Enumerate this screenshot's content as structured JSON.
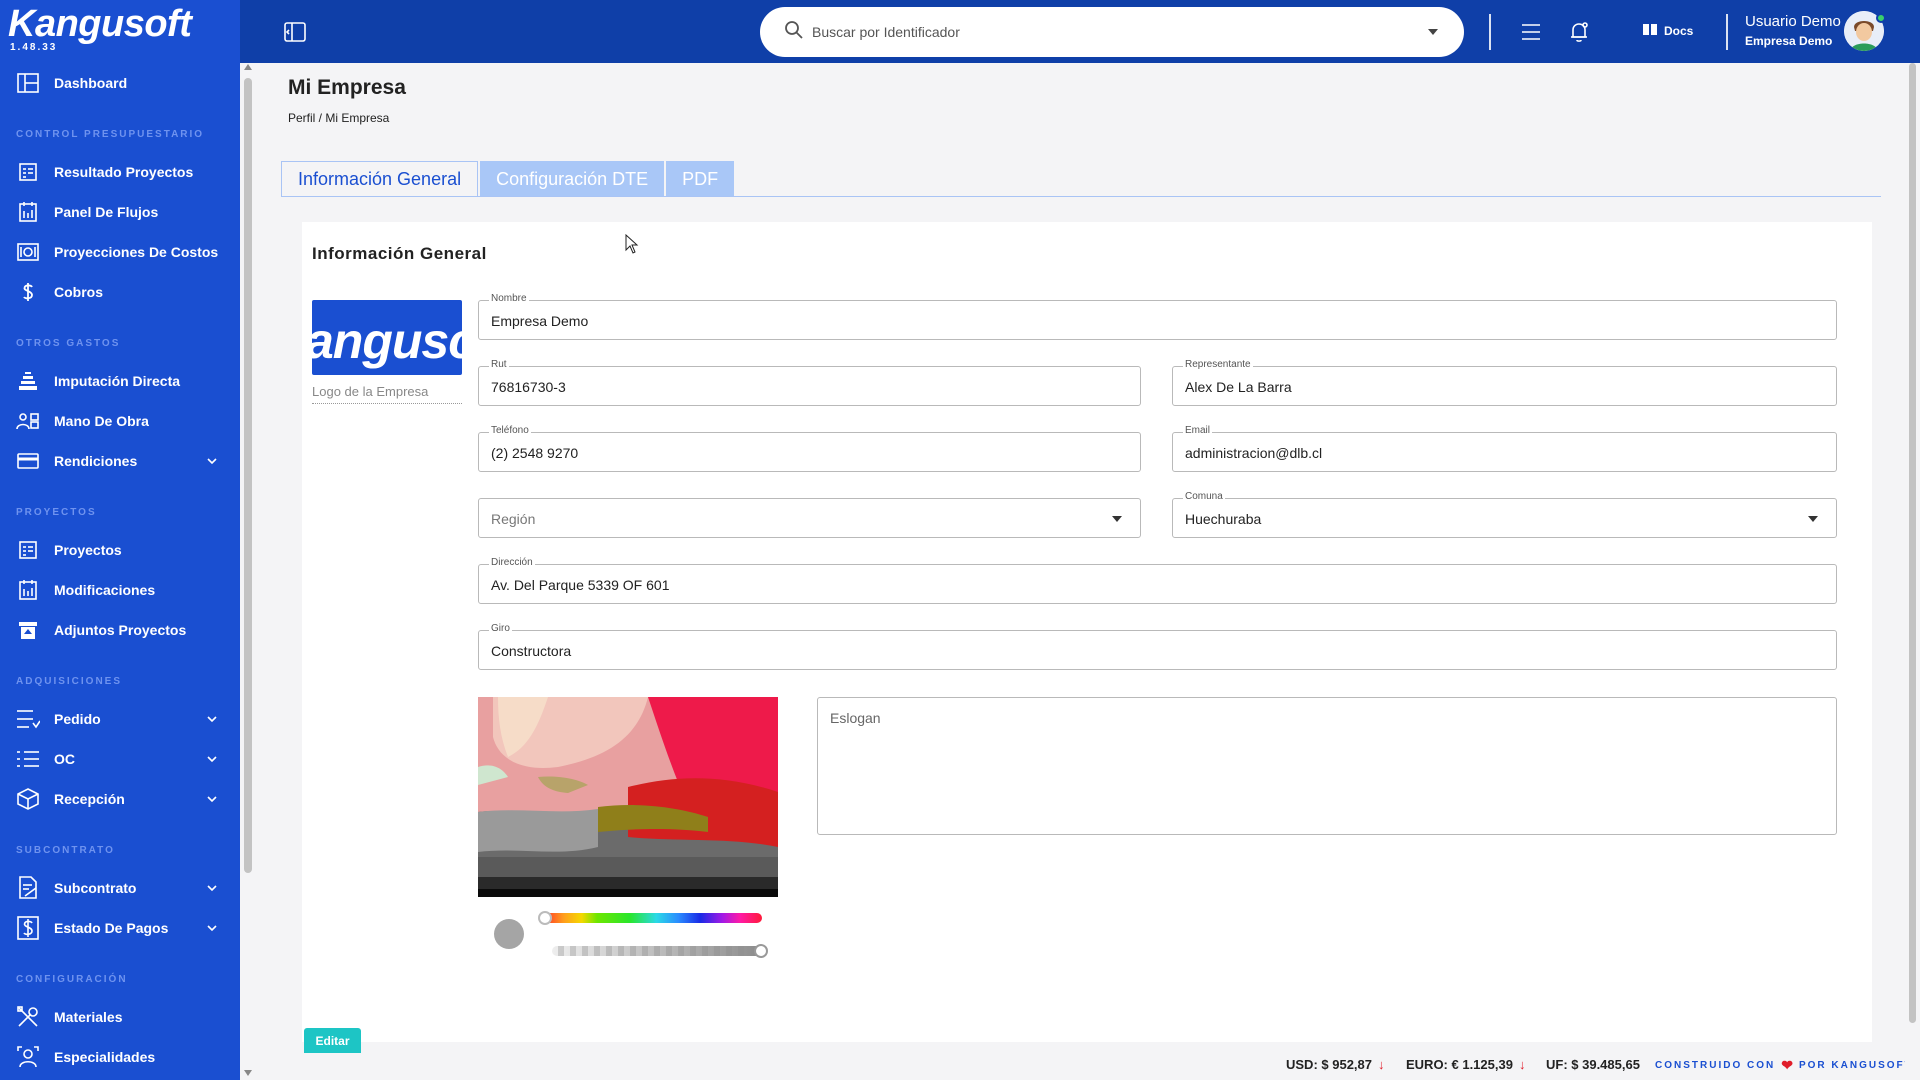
{
  "app": {
    "brand": "Kangusoft",
    "version": "1.48.33"
  },
  "sidebar": {
    "items": [
      {
        "label": "Dashboard",
        "icon": "dashboard-icon"
      },
      {
        "section": "CONTROL PRESUPUESTARIO"
      },
      {
        "label": "Resultado Proyectos",
        "icon": "report-icon"
      },
      {
        "label": "Panel De Flujos",
        "icon": "flow-icon"
      },
      {
        "label": "Proyecciones De Costos",
        "icon": "projection-icon"
      },
      {
        "label": "Cobros",
        "icon": "dollar-icon"
      },
      {
        "section": "OTROS GASTOS"
      },
      {
        "label": "Imputación Directa",
        "icon": "stack-icon"
      },
      {
        "label": "Mano De Obra",
        "icon": "workers-icon"
      },
      {
        "label": "Rendiciones",
        "icon": "card-icon",
        "expandable": true
      },
      {
        "section": "PROYECTOS"
      },
      {
        "label": "Proyectos",
        "icon": "report-icon"
      },
      {
        "label": "Modificaciones",
        "icon": "flow-icon"
      },
      {
        "label": "Adjuntos Proyectos",
        "icon": "attachment-icon"
      },
      {
        "section": "ADQUISICIONES"
      },
      {
        "label": "Pedido",
        "icon": "list-icon",
        "expandable": true
      },
      {
        "label": "OC",
        "icon": "checklist-icon",
        "expandable": true
      },
      {
        "label": "Recepción",
        "icon": "box-icon",
        "expandable": true
      },
      {
        "section": "SUBCONTRATO"
      },
      {
        "label": "Subcontrato",
        "icon": "contract-icon",
        "expandable": true
      },
      {
        "label": "Estado De Pagos",
        "icon": "payment-icon",
        "expandable": true
      },
      {
        "section": "CONFIGURACIÓN"
      },
      {
        "label": "Materiales",
        "icon": "tools-icon"
      },
      {
        "label": "Especialidades",
        "icon": "specialist-icon"
      }
    ]
  },
  "topbar": {
    "search_placeholder": "Buscar por Identificador",
    "docs_label": "Docs",
    "user_name": "Usuario Demo",
    "user_company": "Empresa Demo"
  },
  "page": {
    "title": "Mi Empresa",
    "breadcrumb": "Perfil / Mi Empresa",
    "tabs": [
      {
        "label": "Información General",
        "active": true
      },
      {
        "label": "Configuración DTE",
        "active": false
      },
      {
        "label": "PDF",
        "active": false
      }
    ]
  },
  "form": {
    "section_title": "Información General",
    "logo_text": "angusc",
    "logo_caption": "Logo de la Empresa",
    "nombre": {
      "label": "Nombre",
      "value": "Empresa Demo"
    },
    "rut": {
      "label": "Rut",
      "value": "76816730-3"
    },
    "representante": {
      "label": "Representante",
      "value": "Alex De La Barra"
    },
    "telefono": {
      "label": "Teléfono",
      "value": "(2) 2548 9270"
    },
    "email": {
      "label": "Email",
      "value": "administracion@dlb.cl"
    },
    "region": {
      "placeholder": "Región"
    },
    "comuna": {
      "label": "Comuna",
      "value": "Huechuraba"
    },
    "direccion": {
      "label": "Dirección",
      "value": "Av. Del Parque 5339 OF 601"
    },
    "giro": {
      "label": "Giro",
      "value": "Constructora"
    },
    "eslogan": {
      "placeholder": "Eslogan"
    },
    "edit_button": "Editar"
  },
  "footer": {
    "usd": "USD: $ 952,87",
    "euro": "EURO: € 1.125,39",
    "uf": "UF: $ 39.485,65",
    "built_prefix": "CONSTRUIDO CON",
    "built_suffix": "POR KANGUSOFT"
  },
  "colors": {
    "sidebar": "#1a4fd1",
    "topbar": "#0f3fa8",
    "accent": "#1a4fd1",
    "edit_button": "#1dc5c5",
    "down_arrow": "#e01d2a"
  }
}
